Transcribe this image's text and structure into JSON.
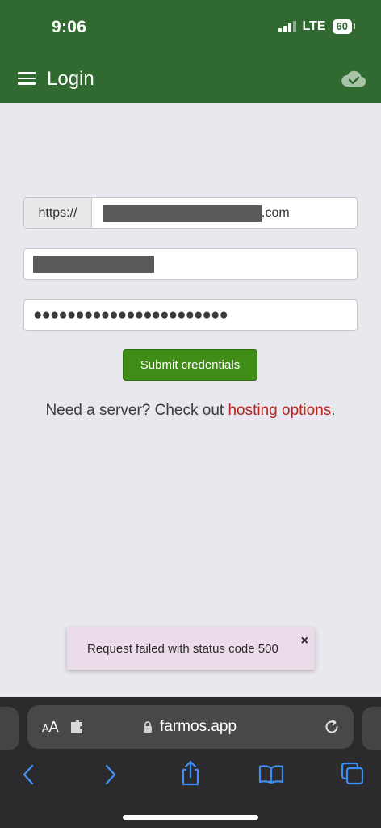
{
  "status_bar": {
    "time": "9:06",
    "network": "LTE",
    "battery": "60"
  },
  "app_bar": {
    "title": "Login",
    "menu_icon": "hamburger-menu-icon",
    "sync_icon": "cloud-check-icon"
  },
  "form": {
    "url_prefix": "https://",
    "url_suffix": ".com",
    "submit_label": "Submit credentials"
  },
  "server_prompt": {
    "text": "Need a server? Check out ",
    "link_text": "hosting options",
    "trailing": "."
  },
  "toast": {
    "message": "Request failed with status code 500",
    "close_glyph": "×"
  },
  "browser": {
    "text_size_label_small": "A",
    "text_size_label_large": "A",
    "domain": "farmos.app"
  },
  "colors": {
    "app_bar": "#316a30",
    "submit": "#3f8d16",
    "link": "#b3261e",
    "toast_bg": "#ecdcea",
    "browser_accent": "#3f8ef0"
  }
}
